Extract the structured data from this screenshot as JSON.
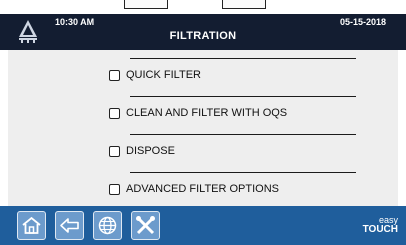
{
  "header": {
    "time": "10:30 AM",
    "title": "FILTRATION",
    "date": "05-15-2018"
  },
  "options": [
    {
      "label": "QUICK FILTER",
      "checked": false
    },
    {
      "label": "CLEAN AND FILTER WITH OQS",
      "checked": false
    },
    {
      "label": "DISPOSE",
      "checked": false
    },
    {
      "label": "ADVANCED FILTER OPTIONS",
      "checked": false
    }
  ],
  "footer": {
    "buttons": [
      "home-icon",
      "back-arrow-icon",
      "globe-icon",
      "tools-icon"
    ],
    "brand_line1": "easy",
    "brand_line2": "TOUCH"
  },
  "colors": {
    "header_bg": "#131d31",
    "content_bg": "#eeeeee",
    "footer_bg": "#1f5e9c",
    "button_bg": "#6c9bcc"
  }
}
